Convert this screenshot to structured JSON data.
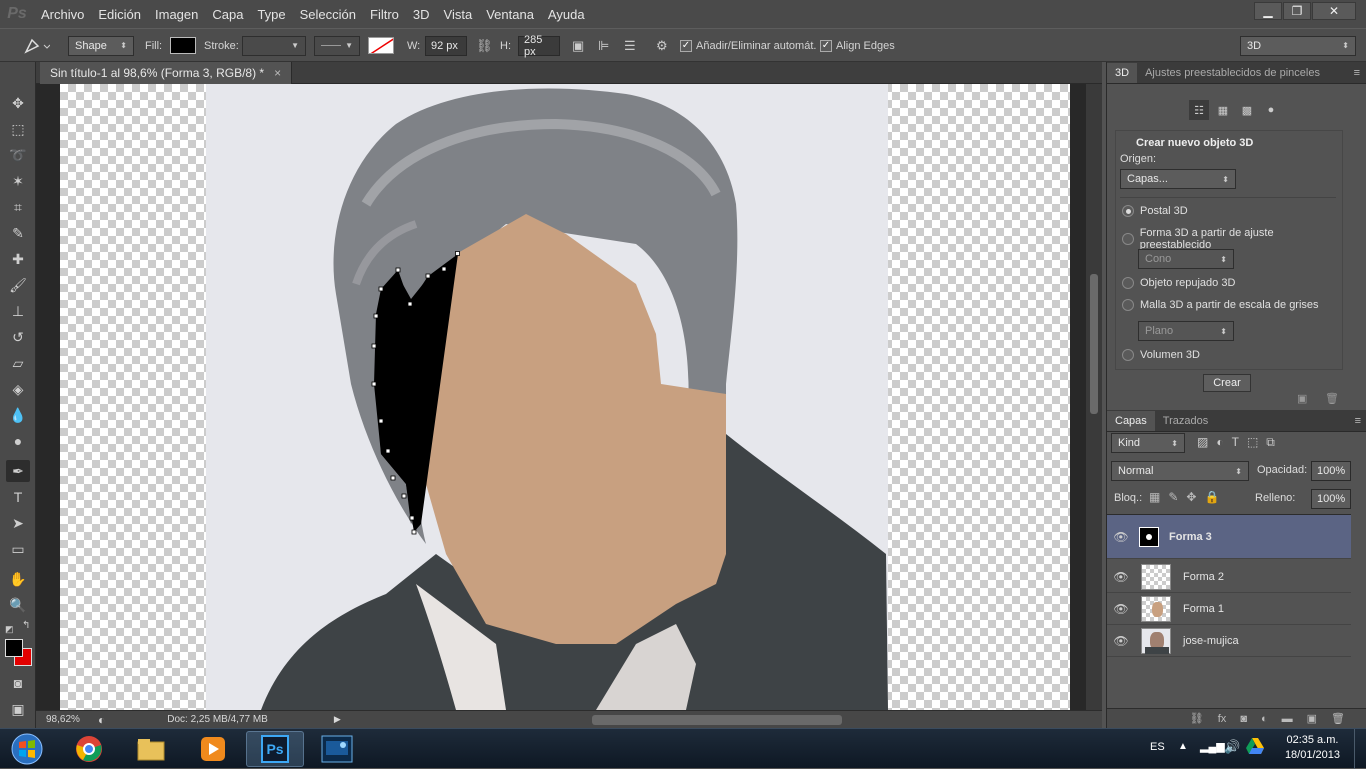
{
  "menubar": {
    "logo": "Ps",
    "items": [
      "Archivo",
      "Edición",
      "Imagen",
      "Capa",
      "Type",
      "Selección",
      "Filtro",
      "3D",
      "Vista",
      "Ventana",
      "Ayuda"
    ],
    "win_min": "▁",
    "win_max": "❐",
    "win_close": "✕"
  },
  "options": {
    "mode": "Shape",
    "fill_label": "Fill:",
    "stroke_label": "Stroke:",
    "w_label": "W:",
    "w_value": "92 px",
    "h_label": "H:",
    "h_value": "285 px",
    "add_remove": "Añadir/Eliminar automát.",
    "align_edges": "Align Edges",
    "workspace": "3D"
  },
  "document": {
    "tab_title": "Sin título-1 al 98,6% (Forma 3, RGB/8) *",
    "zoom": "98,62%",
    "doc_info": "Doc: 2,25 MB/4,77 MB"
  },
  "panel3d": {
    "tab_3d": "3D",
    "tab_presets": "Ajustes preestablecidos de pinceles",
    "title": "Crear nuevo objeto 3D",
    "origin_label": "Origen:",
    "origin_value": "Capas...",
    "opt_postal": "Postal 3D",
    "opt_forma": "Forma 3D a partir de ajuste preestablecido",
    "cono": "Cono",
    "opt_repujado": "Objeto repujado 3D",
    "opt_malla": "Malla 3D a partir de escala de grises",
    "plano": "Plano",
    "opt_volumen": "Volumen 3D",
    "create_btn": "Crear"
  },
  "layers": {
    "tab_capas": "Capas",
    "tab_trazados": "Trazados",
    "kind": "Kind",
    "blend": "Normal",
    "opacity_label": "Opacidad:",
    "opacity_value": "100%",
    "lock_label": "Bloq.:",
    "fill_label": "Relleno:",
    "fill_value": "100%",
    "items": [
      {
        "name": "Forma 3"
      },
      {
        "name": "Forma 2"
      },
      {
        "name": "Forma 1"
      },
      {
        "name": "jose-mujica"
      }
    ]
  },
  "taskbar": {
    "lang": "ES",
    "time": "02:35 a.m.",
    "date": "18/01/2013",
    "ps_label": "Ps"
  },
  "colors": {
    "skin": "#c8a080",
    "selected_layer": "#5b6484",
    "accent": "#2d2d2d"
  }
}
